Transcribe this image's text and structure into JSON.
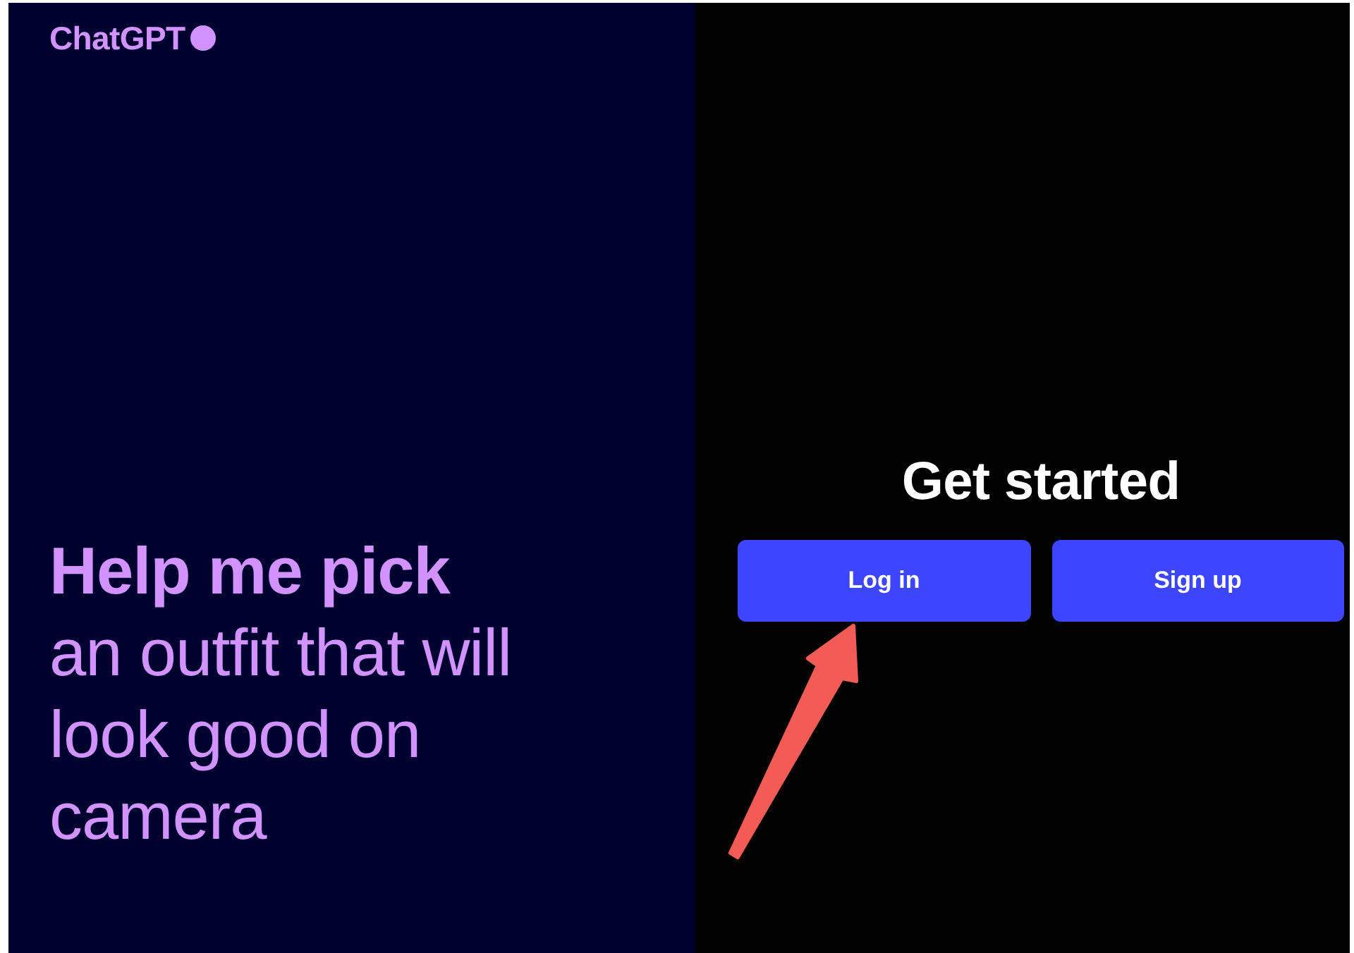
{
  "logo": {
    "text": "ChatGPT"
  },
  "prompt": {
    "headline": "Help me pick",
    "continuation": "an outfit that will look good on camera"
  },
  "auth": {
    "title": "Get started",
    "buttons": [
      {
        "label": "Log in"
      },
      {
        "label": "Sign up"
      }
    ]
  },
  "annotations": [
    {
      "kind": "arrow"
    }
  ]
}
